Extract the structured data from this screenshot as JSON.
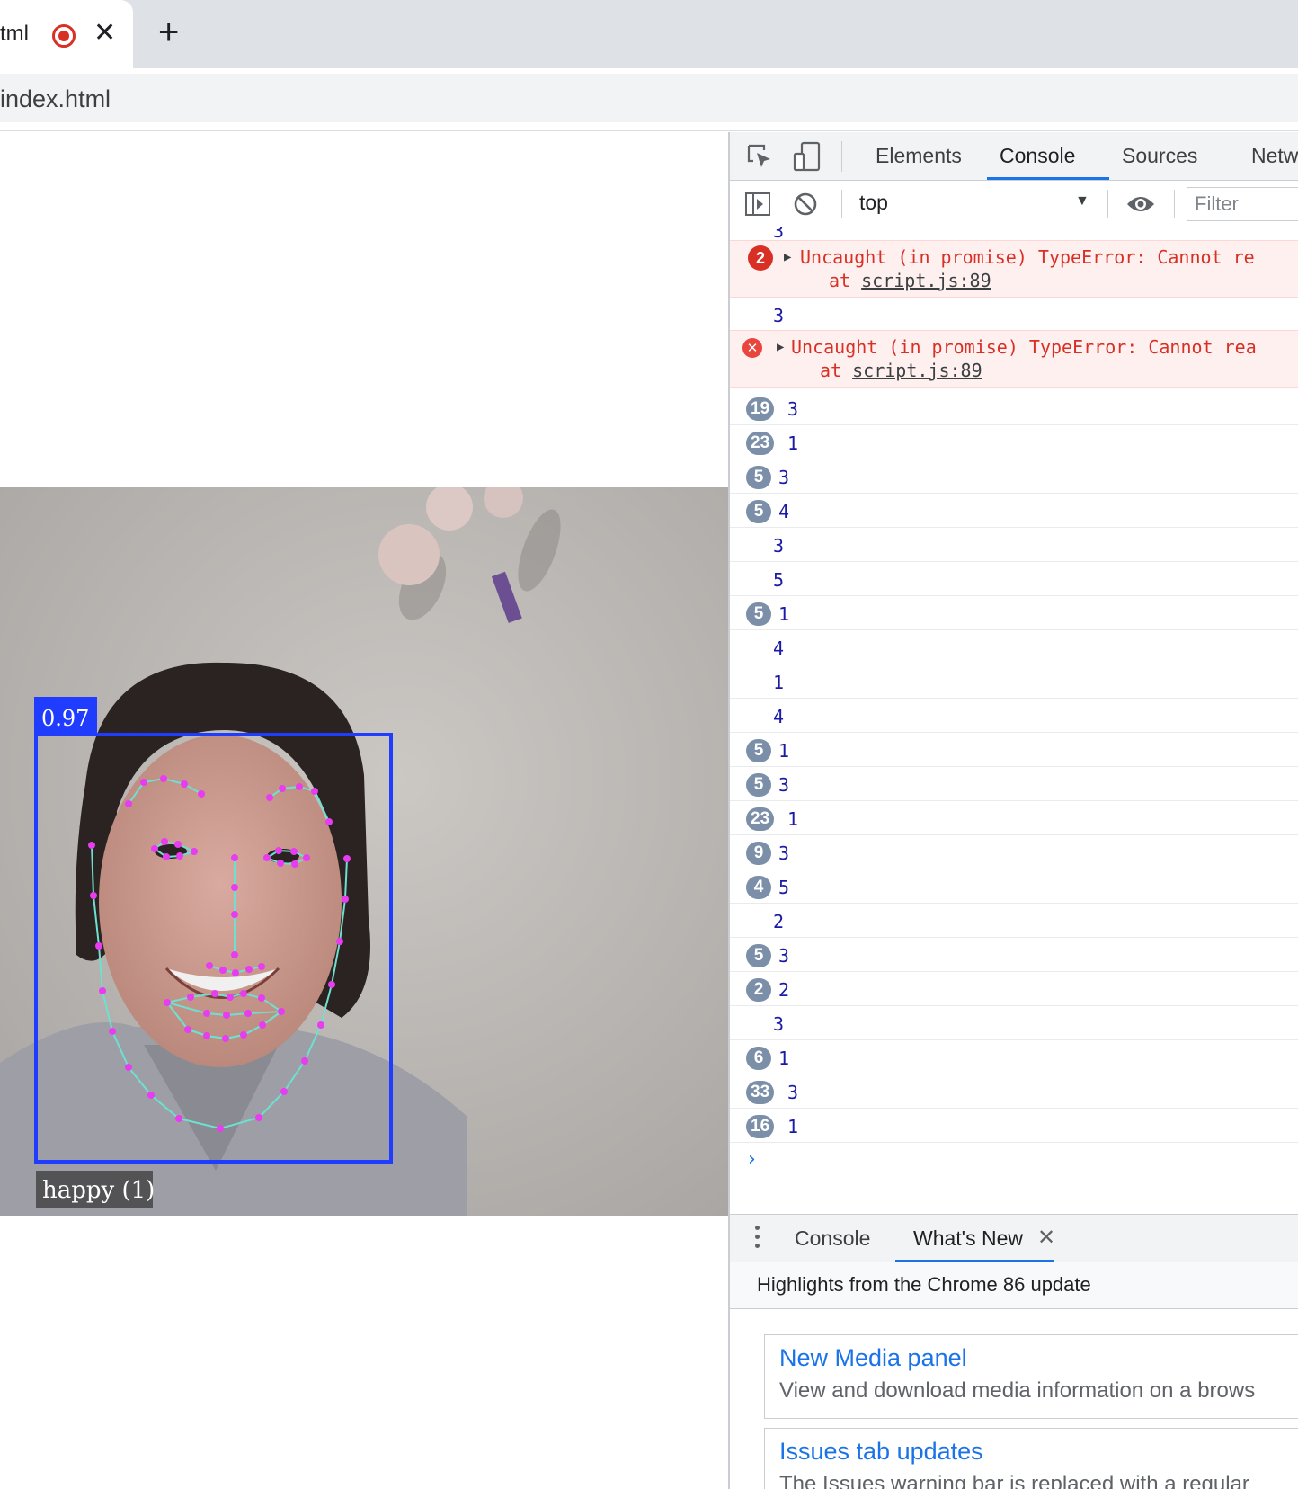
{
  "browser": {
    "tab_title": "tml",
    "tab_close": "✕",
    "new_tab": "+",
    "url": "index.html"
  },
  "video": {
    "confidence_label": "0.97",
    "expression_label": "happy (1)",
    "box_color": "#1f3cff",
    "landmark_point_color": "#e83cf0",
    "landmark_line_color": "#6ee0d0"
  },
  "devtools": {
    "tabs": [
      "Elements",
      "Console",
      "Sources",
      "Netw"
    ],
    "active_tab": "Console",
    "context": "top",
    "filter_placeholder": "Filter",
    "partial_top_value": "3",
    "errors": [
      {
        "count": "2",
        "message": "Uncaught (in promise) TypeError: Cannot re",
        "at": "at",
        "location": "script.js:89"
      },
      {
        "count": "",
        "message": "Uncaught (in promise) TypeError: Cannot rea",
        "at": "at",
        "location": "script.js:89"
      }
    ],
    "between_value": "3",
    "logs": [
      {
        "count": "19",
        "value": "3"
      },
      {
        "count": "23",
        "value": "1"
      },
      {
        "count": "5",
        "value": "3"
      },
      {
        "count": "5",
        "value": "4"
      },
      {
        "count": "",
        "value": "3"
      },
      {
        "count": "",
        "value": "5"
      },
      {
        "count": "5",
        "value": "1"
      },
      {
        "count": "",
        "value": "4"
      },
      {
        "count": "",
        "value": "1"
      },
      {
        "count": "",
        "value": "4"
      },
      {
        "count": "5",
        "value": "1"
      },
      {
        "count": "5",
        "value": "3"
      },
      {
        "count": "23",
        "value": "1"
      },
      {
        "count": "9",
        "value": "3"
      },
      {
        "count": "4",
        "value": "5"
      },
      {
        "count": "",
        "value": "2"
      },
      {
        "count": "5",
        "value": "3"
      },
      {
        "count": "2",
        "value": "2"
      },
      {
        "count": "",
        "value": "3"
      },
      {
        "count": "6",
        "value": "1"
      },
      {
        "count": "33",
        "value": "3"
      },
      {
        "count": "16",
        "value": "1"
      }
    ],
    "prompt": "›",
    "drawer": {
      "tabs": [
        "Console",
        "What's New"
      ],
      "close": "✕",
      "heading": "Highlights from the Chrome 86 update",
      "cards": [
        {
          "title": "New Media panel",
          "desc": "View and download media information on a brows"
        },
        {
          "title": "Issues tab updates",
          "desc": "The Issues warning bar is replaced with a regular"
        }
      ]
    }
  }
}
